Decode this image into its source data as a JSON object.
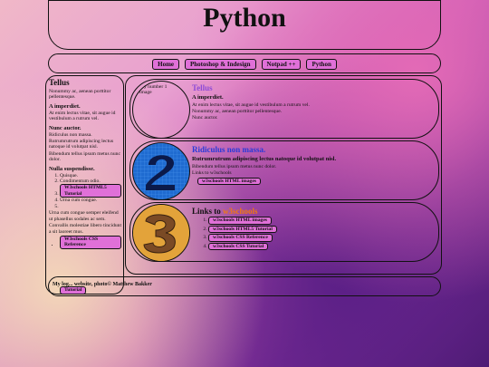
{
  "header": {
    "title": "Python"
  },
  "nav": {
    "items": [
      "Home",
      "Photoshop & Indesign",
      "Notpad ++",
      "Python"
    ]
  },
  "sidebar": {
    "title": "Tellus",
    "intro": "Nonummy ac, aenean porttitor pellentesque.",
    "h1": "A imperdiet.",
    "p1": "At enim lectus vitae, sit augue id vestibulum a rutrum vel.",
    "h2": "Nunc auctor.",
    "p2a": "Ridiculus non massa.",
    "p2b": "Rutrumrutrum adipiscing lectus natoque id volutpat nisl.",
    "p2c": "Bibendum tellus ipsum metus nunc dolor.",
    "h3": "Nulla suspendisse.",
    "list": [
      "Quisque.",
      "Condimentum odio.",
      "W3schools HTML5 Tutorial",
      "Urna cum congue.",
      ""
    ],
    "p3": "Urna cum congue semper eleifend ut phasellus sodales ac sem.",
    "p4": "Convallis molestiae libero tincidunt a sit laoreet mus.",
    "bullet": "W3schools CSS Reference",
    "overflow_link": "Tutorial"
  },
  "cards": [
    {
      "image_alt": "My number 1 image",
      "title": "Tellus",
      "title_color": "#8e4bd6",
      "subtitle": "A imperdiet.",
      "lines": [
        "At enim lectus vitae, sit augue id vestibulum a rutrum vel.",
        "Nonummy ac, aenean porttitor pellentesque.",
        "Nunc auctor."
      ]
    },
    {
      "title": "Ridiculus non massa.",
      "title_color": "#2b3ad8",
      "subtitle": "Rutrumrutrum adipiscing lectus natoque id volutpat nisl.",
      "lines": [
        "Bibendum tellus ipsum metus nunc dolor.",
        "Links to w3schools"
      ],
      "button": "w3schools HTML images"
    },
    {
      "title_prefix": "Links to ",
      "title_accent": "w3schools",
      "title_accent_color": "#f07a10",
      "links": [
        "w3schools HTML images",
        "w3schools HTML5 Tutorial",
        "w3schools CSS Reference",
        "w3schools CSS Tutorial"
      ]
    }
  ],
  "footer": {
    "text": "My log... website, photo© Matthew Bakker"
  },
  "colors": {
    "accent": "#e070d8",
    "border": "#111111"
  }
}
